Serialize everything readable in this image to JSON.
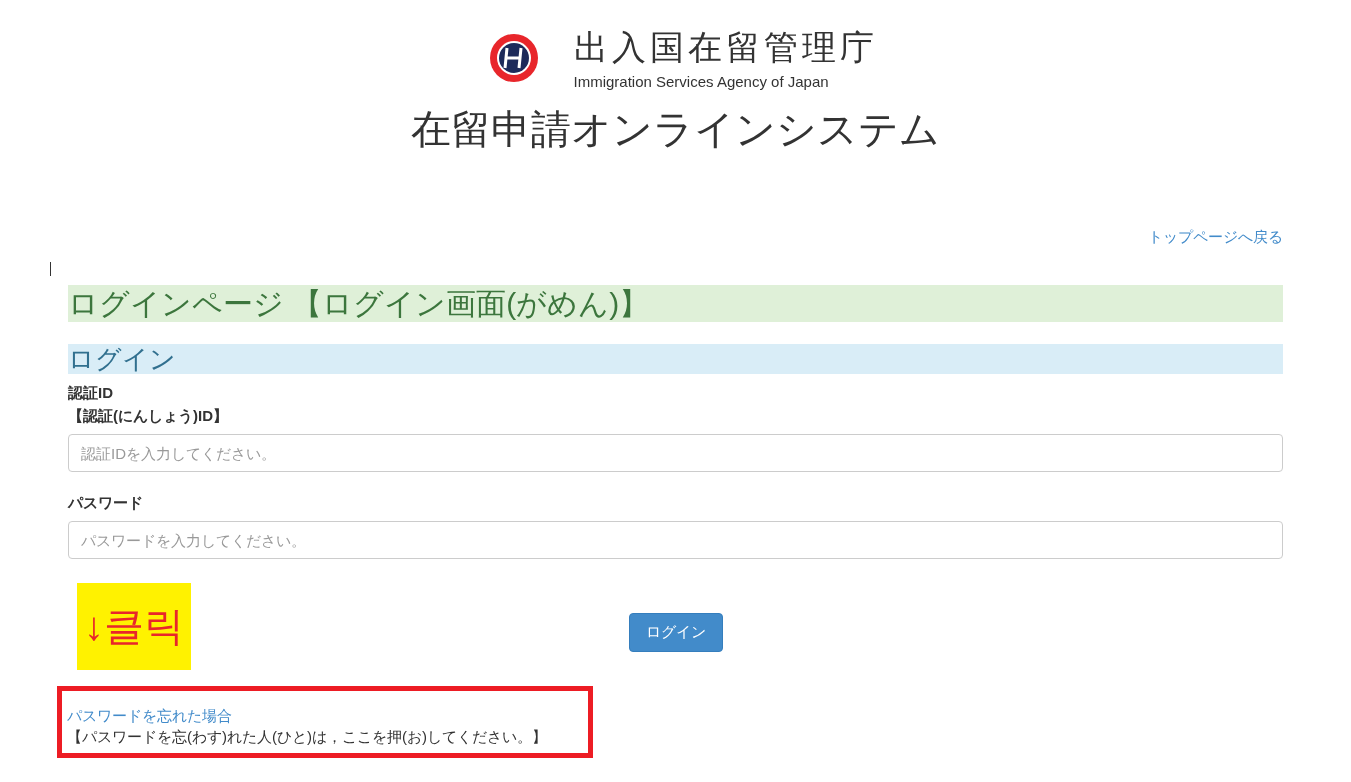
{
  "header": {
    "agency_name": "出入国在留管理庁",
    "agency_name_en": "Immigration Services Agency of Japan",
    "system_title": "在留申請オンラインシステム"
  },
  "top_link": "トップページへ戻る",
  "page_heading": "ログインページ 【ログイン画面(がめん)】",
  "section_heading": "ログイン",
  "fields": [
    {
      "label": "認証ID",
      "sublabel": "【認証(にんしょう)ID】",
      "placeholder": "認証IDを入力してください。"
    },
    {
      "label": "パスワード",
      "placeholder": "パスワードを入力してください。"
    }
  ],
  "annotation": {
    "text": "↓클릭"
  },
  "login_button": "ログイン",
  "forgot": {
    "link": "パスワードを忘れた場合",
    "note": "【パスワードを忘(わす)れた人(ひと)は，ここを押(お)してください。】"
  }
}
